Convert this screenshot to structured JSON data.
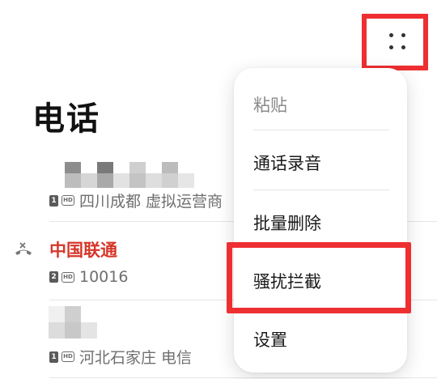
{
  "header": {
    "title": "电话",
    "more_icon": "more-dots-icon"
  },
  "call_log": [
    {
      "name": "",
      "sim": "1",
      "hd": "HD",
      "detail": "四川成都 虚拟运营商",
      "missed": false
    },
    {
      "name": "中国联通",
      "sim": "2",
      "hd": "HD",
      "detail": "10016",
      "missed": true
    },
    {
      "name": "",
      "sim": "1",
      "hd": "HD",
      "detail": "河北石家庄 电信",
      "missed": false
    }
  ],
  "menu": {
    "items": [
      {
        "label": "粘贴",
        "enabled": false
      },
      {
        "label": "通话录音",
        "enabled": true
      },
      {
        "label": "批量删除",
        "enabled": true
      },
      {
        "label": "骚扰拦截",
        "enabled": true,
        "highlighted": true
      },
      {
        "label": "设置",
        "enabled": true
      }
    ]
  },
  "colors": {
    "highlight": "#ee2f32",
    "missed": "#d6362a"
  }
}
